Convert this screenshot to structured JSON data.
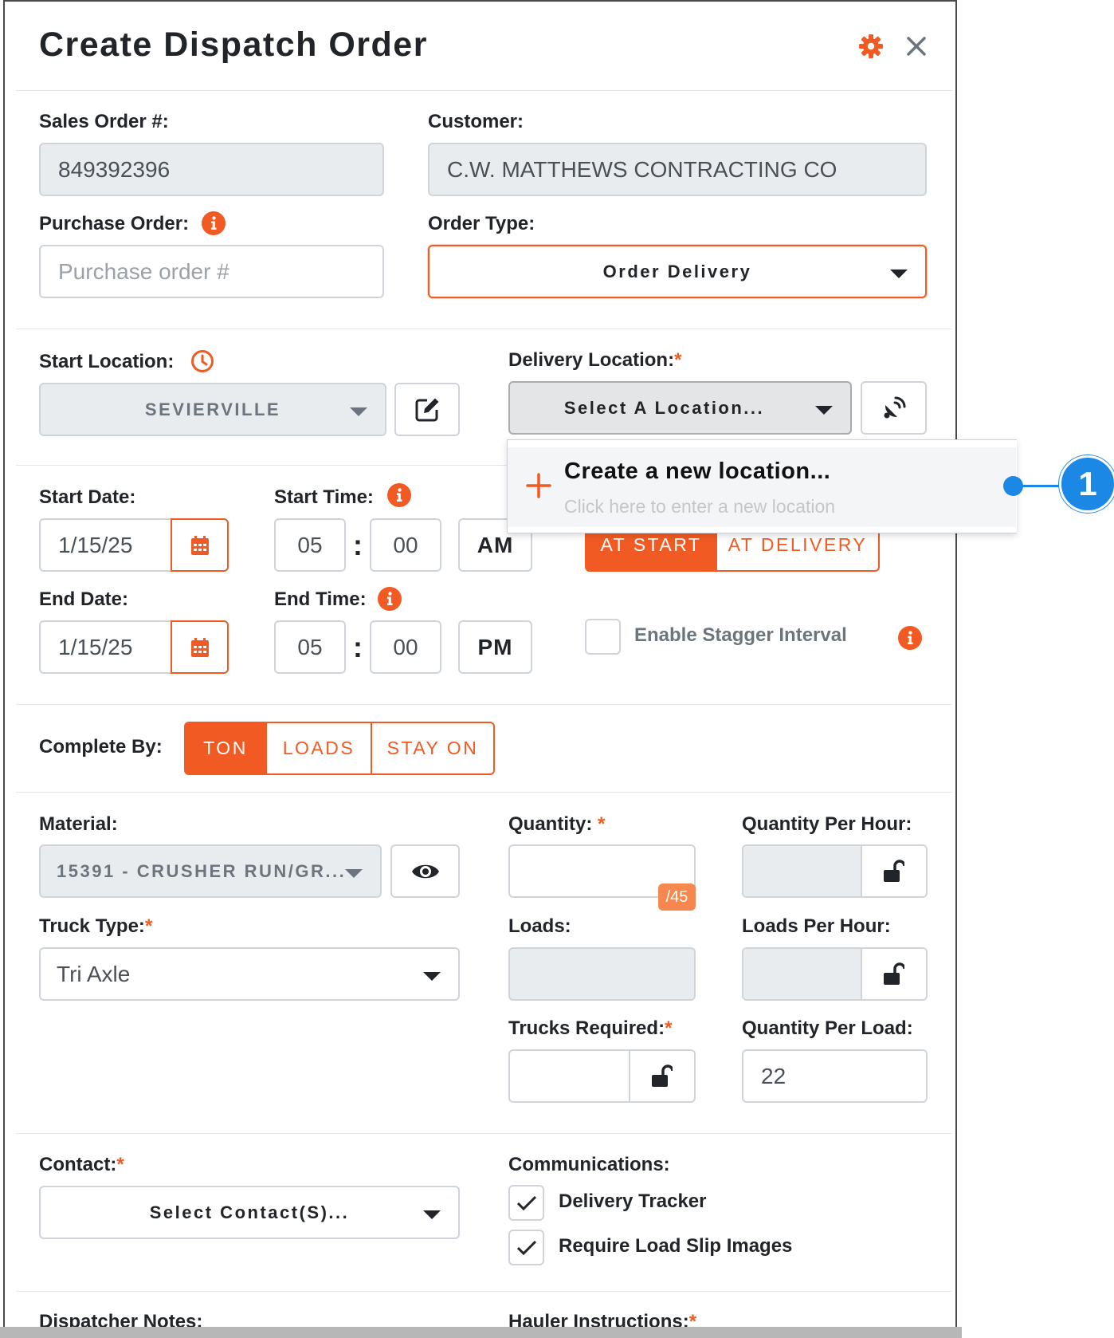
{
  "modal": {
    "title": "Create Dispatch Order"
  },
  "sales_order": {
    "label": "Sales Order #:",
    "value": "849392396"
  },
  "customer": {
    "label": "Customer:",
    "value": "C.W. MATTHEWS CONTRACTING CO"
  },
  "purchase_order": {
    "label": "Purchase Order:",
    "placeholder": "Purchase order #"
  },
  "order_type": {
    "label": "Order Type:",
    "value": "Order Delivery"
  },
  "start_location": {
    "label": "Start Location:",
    "value": "SEVIERVILLE"
  },
  "delivery_location": {
    "label": "Delivery Location:",
    "required": "*",
    "value": "Select A Location..."
  },
  "location_dropdown": {
    "title": "Create a new location...",
    "subtitle": "Click here to enter a new location"
  },
  "callout": {
    "number": "1"
  },
  "start_date": {
    "label": "Start Date:",
    "value": "1/15/25"
  },
  "start_time": {
    "label": "Start Time:",
    "hour": "05",
    "minute": "00",
    "ampm": "AM"
  },
  "end_date": {
    "label": "End Date:",
    "value": "1/15/25"
  },
  "end_time": {
    "label": "End Time:",
    "hour": "05",
    "minute": "00",
    "ampm": "PM"
  },
  "colon": ":",
  "timing": {
    "options": [
      "AT START",
      "AT DELIVERY"
    ],
    "selected": "AT START"
  },
  "stagger": {
    "label": "Enable Stagger Interval",
    "checked": false
  },
  "complete_by": {
    "label": "Complete By:",
    "options": [
      "TON",
      "LOADS",
      "STAY ON"
    ],
    "selected": "TON"
  },
  "material": {
    "label": "Material:",
    "value": "15391 - CRUSHER RUN/GR..."
  },
  "quantity": {
    "label": "Quantity:",
    "required": "*",
    "value": "",
    "badge": "/45"
  },
  "quantity_per_hour": {
    "label": "Quantity Per Hour:"
  },
  "truck_type": {
    "label": "Truck Type:",
    "required": "*",
    "value": "Tri Axle"
  },
  "loads": {
    "label": "Loads:"
  },
  "loads_per_hour": {
    "label": "Loads Per Hour:"
  },
  "trucks_required": {
    "label": "Trucks Required:",
    "required": "*"
  },
  "quantity_per_load": {
    "label": "Quantity Per Load:",
    "value": "22"
  },
  "contact": {
    "label": "Contact:",
    "required": "*",
    "value": "Select Contact(S)..."
  },
  "communications": {
    "label": "Communications:",
    "items": [
      {
        "label": "Delivery Tracker",
        "checked": true
      },
      {
        "label": "Require Load Slip Images",
        "checked": true
      }
    ]
  },
  "dispatcher_notes": {
    "label": "Dispatcher Notes:"
  },
  "hauler_instructions": {
    "label": "Hauler Instructions:",
    "required": "*"
  },
  "colors": {
    "accent": "#f15a22",
    "callout": "#1b88e5",
    "readonly_bg": "#e9ecef"
  }
}
